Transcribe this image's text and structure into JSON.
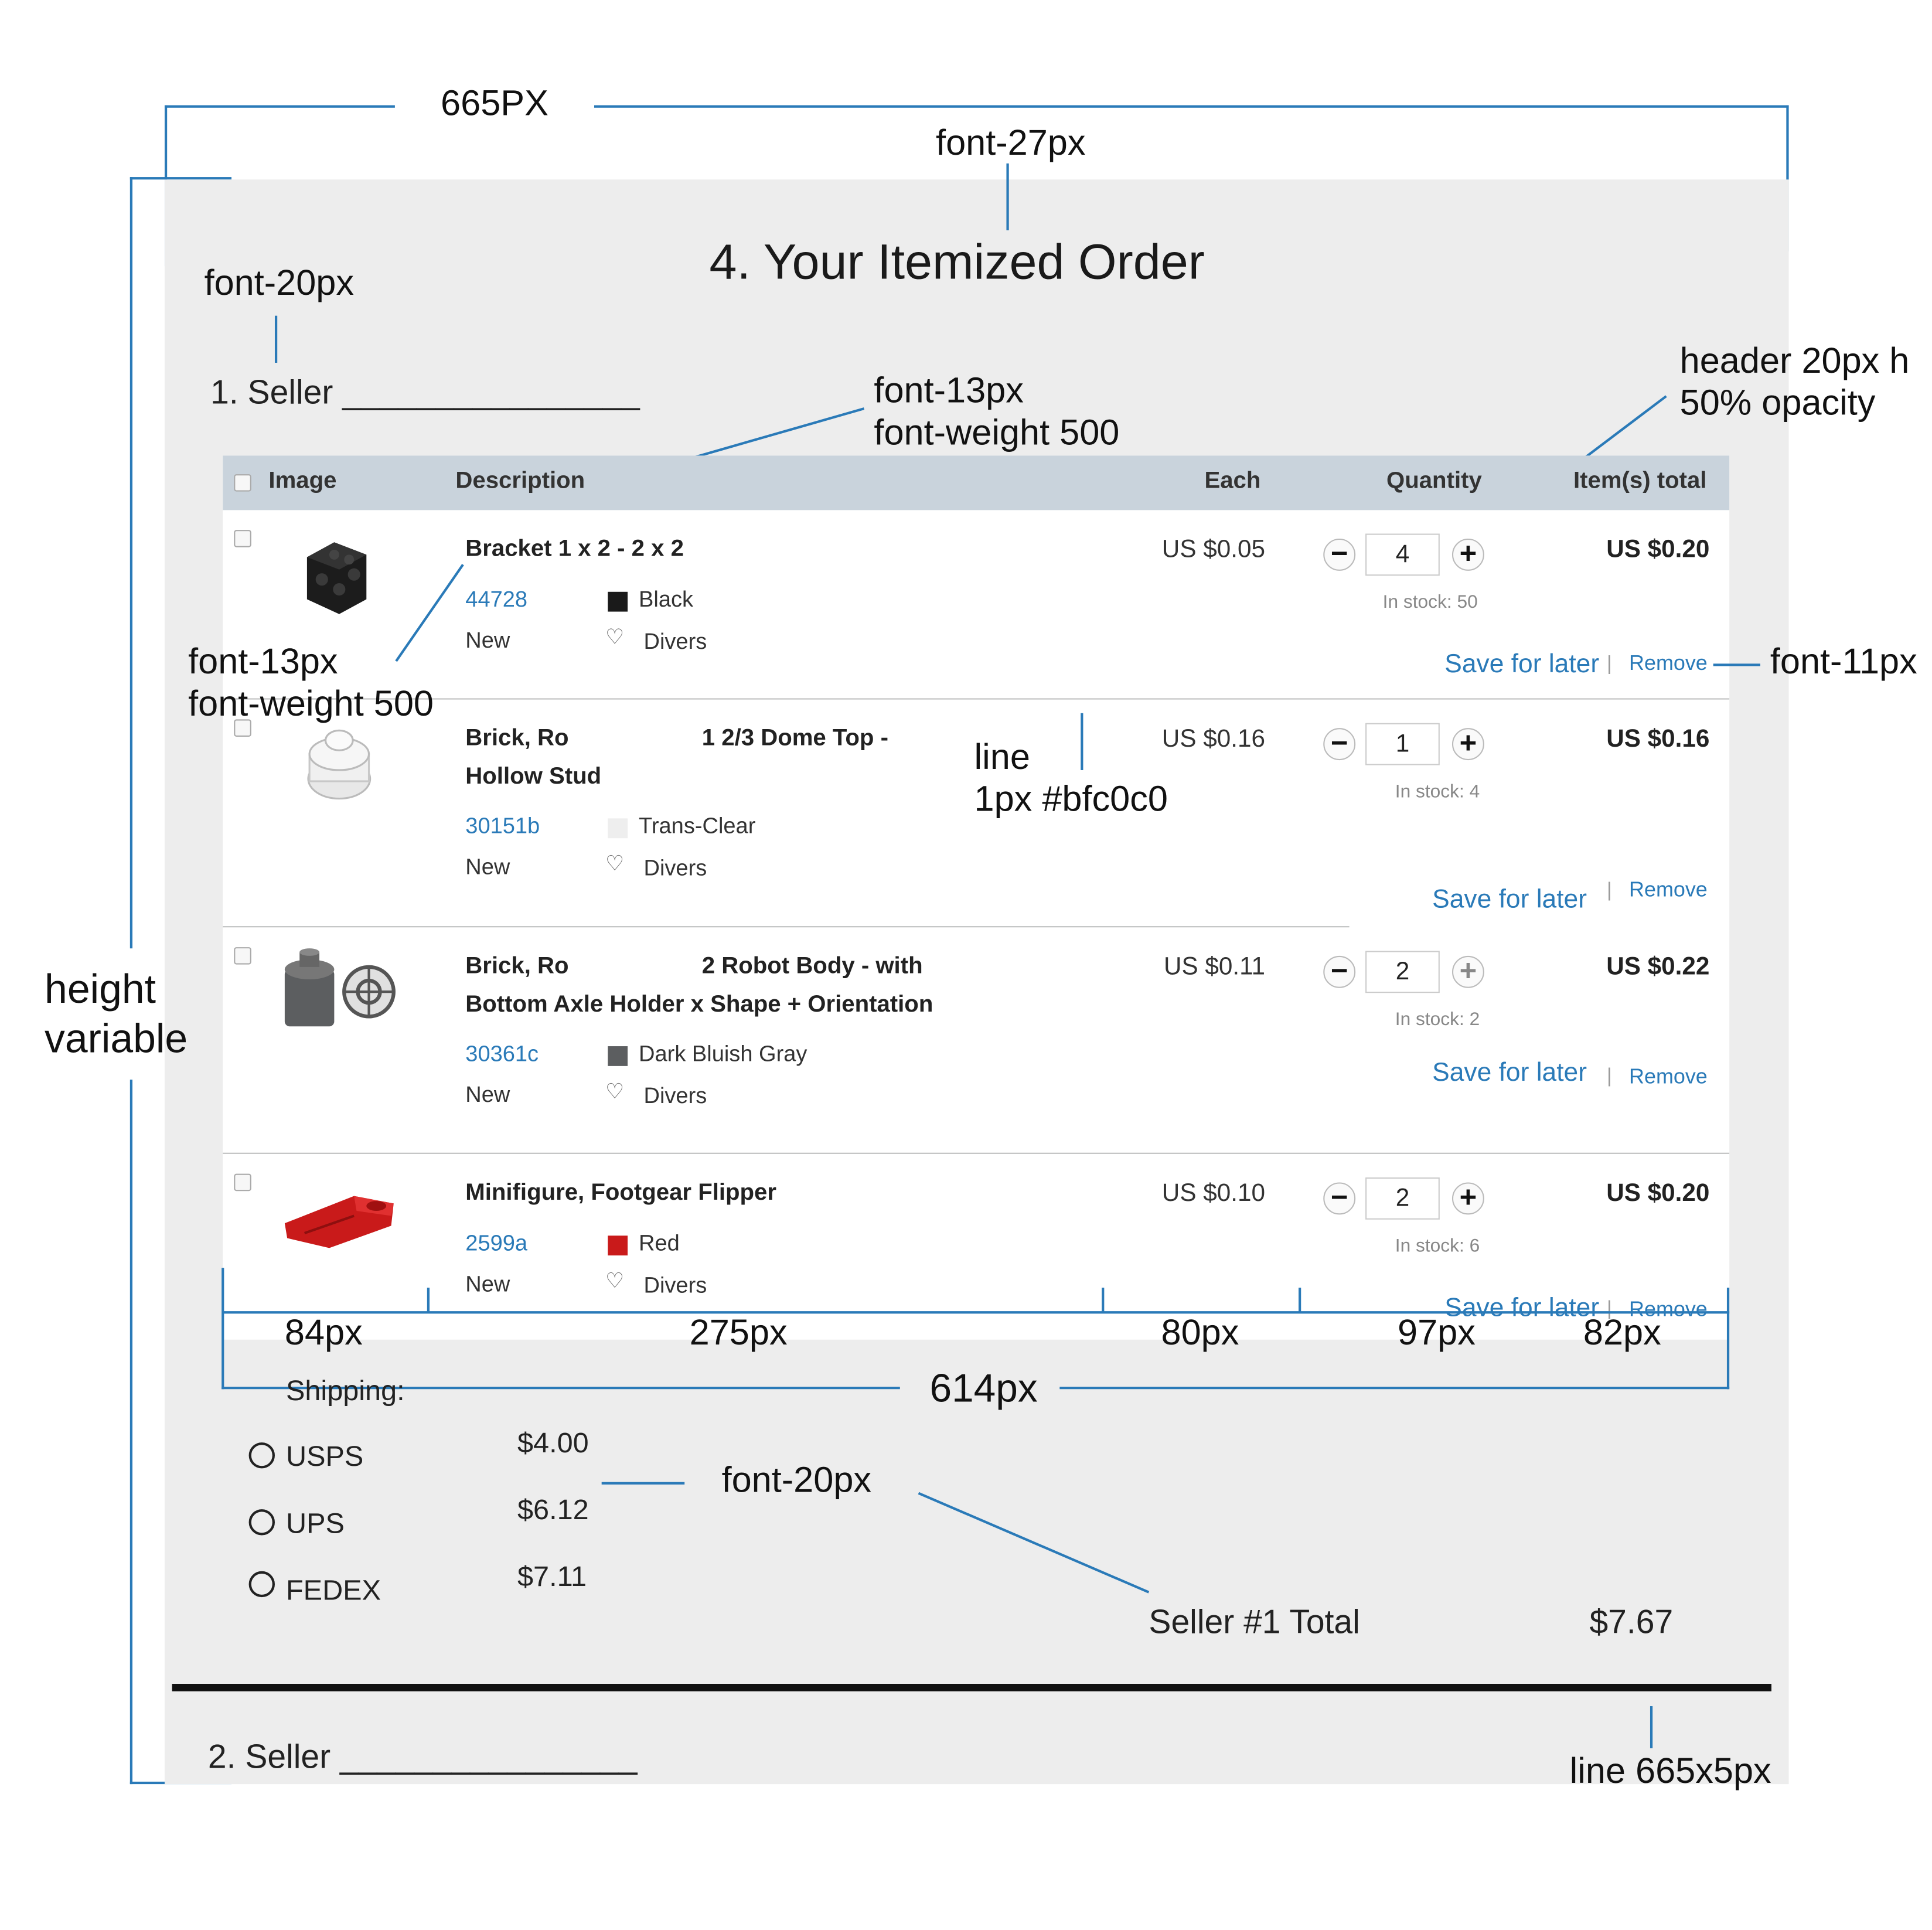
{
  "annotations": {
    "width_665": "665PX",
    "font_27": "font-27px",
    "font_20_top": "font-20px",
    "font_13_header": "font-13px",
    "weight_500_header": "font-weight 500",
    "header_h": "header 20px h",
    "header_opacity": "50% opacity",
    "font_13_item": "font-13px",
    "weight_500_item": "font-weight 500",
    "font_11": "font-11px",
    "line": "line",
    "line_color": "1px #bfc0c0",
    "height": "height",
    "variable": "variable",
    "col_84": "84px",
    "col_275": "275px",
    "col_80": "80px",
    "col_97": "97px",
    "col_82": "82px",
    "width_614": "614px",
    "font_20_bottom": "font-20px",
    "line_665": "line  665x5px"
  },
  "page": {
    "title": "4. Your Itemized Order",
    "seller1": "1. Seller ________________",
    "seller2": "2. Seller ________________"
  },
  "table": {
    "headers": {
      "image": "Image",
      "description": "Description",
      "each": "Each",
      "quantity": "Quantity",
      "total": "Item(s) total"
    },
    "save_label": "Save for later",
    "remove_label": "Remove",
    "divers_label": "Divers",
    "rows": [
      {
        "name_line1": "Bracket 1 x 2 - 2 x 2",
        "name_line2": "",
        "code": "44728",
        "condition": "New",
        "color": "Black",
        "swatch": "#1a1a1a",
        "each": "US $0.05",
        "qty": "4",
        "stock": "In stock: 50",
        "total": "US $0.20"
      },
      {
        "name_line1": "Brick, Ro",
        "name_line1b": "1 2/3 Dome Top -",
        "name_line2": "Hollow Stud",
        "code": "30151b",
        "condition": "New",
        "color": "Trans-Clear",
        "swatch": "#eeeeee",
        "each": "US $0.16",
        "qty": "1",
        "stock": "In stock: 4",
        "total": "US $0.16"
      },
      {
        "name_line1": "Brick, Ro",
        "name_line1b": "2 Robot Body - with",
        "name_line2": "Bottom Axle Holder x Shape + Orientation",
        "code": "30361c",
        "condition": "New",
        "color": "Dark Bluish Gray",
        "swatch": "#5c5e60",
        "each": "US $0.11",
        "qty": "2",
        "stock": "In stock: 2",
        "total": "US $0.22"
      },
      {
        "name_line1": "Minifigure, Footgear Flipper",
        "name_line2": "",
        "code": "2599a",
        "condition": "New",
        "color": "Red",
        "swatch": "#c91a1a",
        "each": "US $0.10",
        "qty": "2",
        "stock": "In stock: 6",
        "total": "US $0.20"
      }
    ]
  },
  "shipping": {
    "label": "Shipping:",
    "options": [
      {
        "name": "USPS",
        "price": "$4.00"
      },
      {
        "name": "UPS",
        "price": "$6.12"
      },
      {
        "name": "FEDEX",
        "price": "$7.11"
      }
    ],
    "total_label": "Seller #1 Total",
    "total_value": "$7.67"
  },
  "colors": {
    "accent": "#2a7ab8",
    "panel": "#ededed",
    "header": "#c9d3dc",
    "row_line": "#bfc0c0"
  }
}
